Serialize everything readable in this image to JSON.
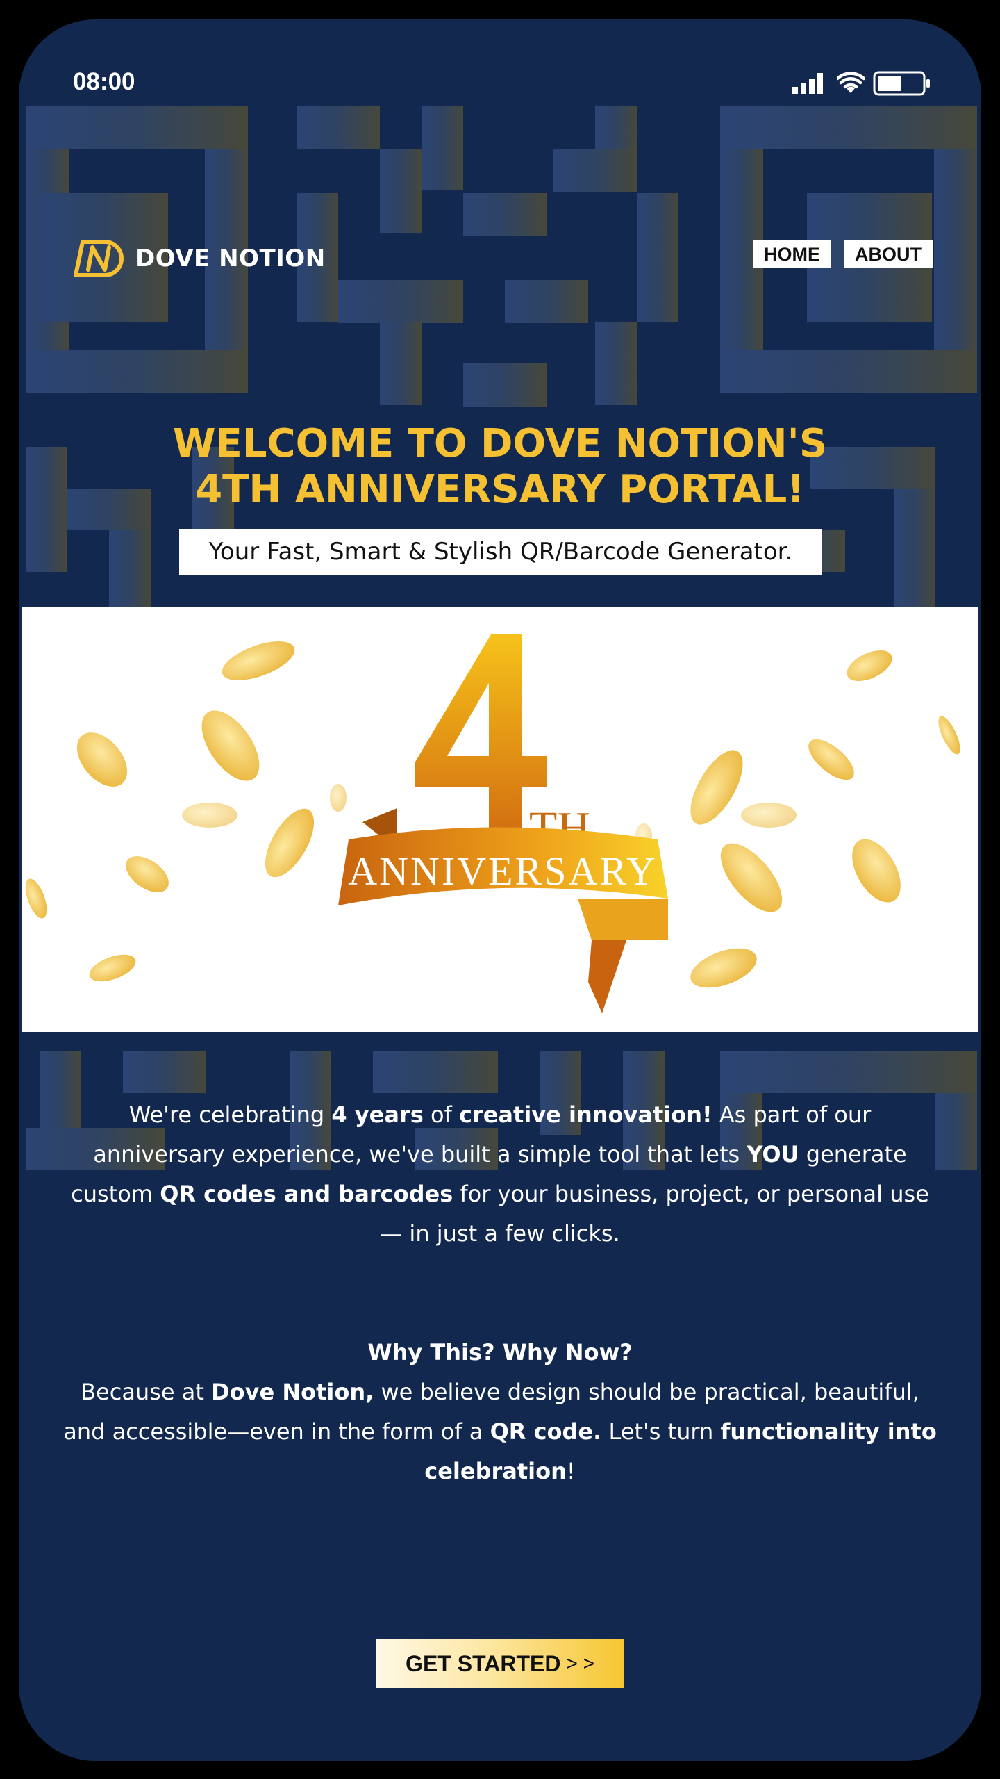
{
  "status_bar": {
    "time": "08:00",
    "icons": [
      "signal-icon",
      "wifi-icon",
      "battery-icon"
    ]
  },
  "brand": {
    "name": "DOVE NOTION",
    "logo_icon": "dn-monogram-icon",
    "accent_color": "#f5c133",
    "background_color": "#13284e"
  },
  "nav": {
    "home": "HOME",
    "about": "ABOUT"
  },
  "hero": {
    "title_line1": "WELCOME TO DOVE NOTION'S",
    "title_line2": "4TH ANNIVERSARY PORTAL!",
    "tagline": "Your Fast, Smart & Stylish QR/Barcode Generator."
  },
  "banner": {
    "number": "4",
    "suffix": "TH",
    "ribbon_text": "ANNIVERSARY"
  },
  "intro": {
    "p1": "We're celebrating ",
    "b1": "4 years",
    "p2": " of ",
    "b2": "creative innovation!",
    "p3": " As part of our anniversary experience, we've built a simple tool that lets ",
    "b3": "YOU",
    "p4": " generate custom ",
    "b4": "QR codes and barcodes",
    "p5": " for your business, project, or personal use — in just a few clicks."
  },
  "why": {
    "title": "Why This? Why Now?",
    "p1": "Because at ",
    "b1": "Dove Notion,",
    "p2": " we believe design should be practical, beautiful, and accessible—even in the form of a ",
    "b2": "QR code.",
    "p3": " Let's turn ",
    "b3": "functionality into celebration",
    "p4": "!"
  },
  "cta": {
    "label": "GET STARTED",
    "arrows": "> >"
  }
}
